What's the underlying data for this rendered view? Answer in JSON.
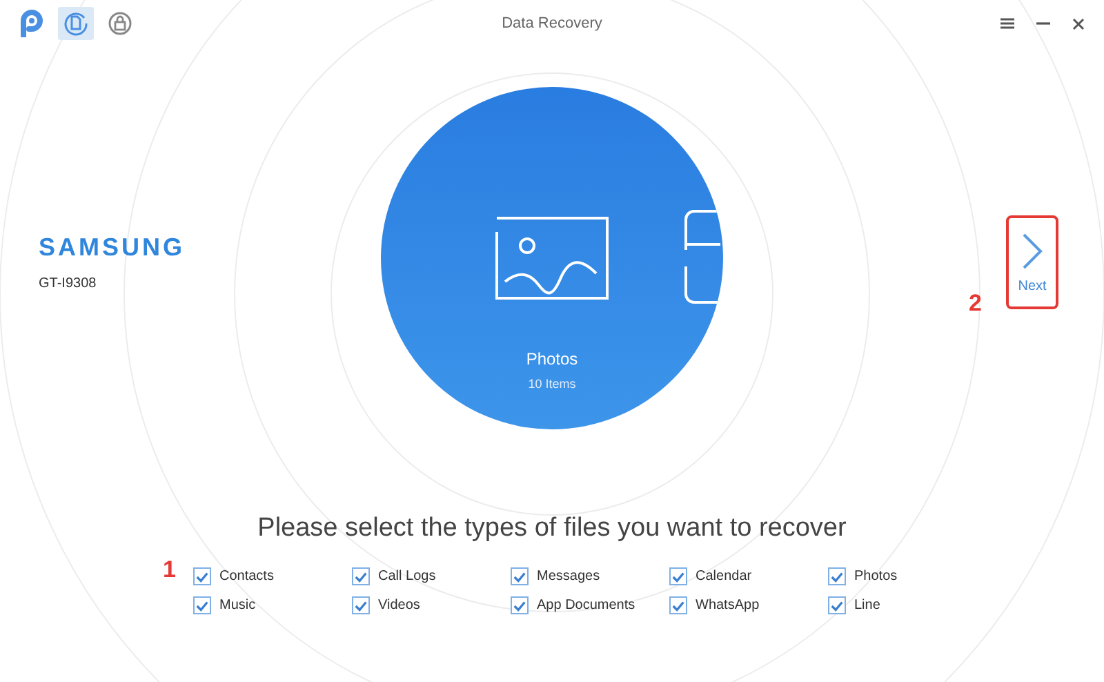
{
  "window": {
    "title": "Data Recovery"
  },
  "toolbar": [
    {
      "kind": "logo",
      "selected": false
    },
    {
      "kind": "recover",
      "selected": true
    },
    {
      "kind": "unlock",
      "selected": false
    }
  ],
  "device": {
    "brand": "SAMSUNG",
    "model": "GT-I9308"
  },
  "carousel": {
    "label": "Photos",
    "count": "10 Items"
  },
  "next_button": {
    "label": "Next",
    "annotation": "2"
  },
  "prompt": "Please select the types of files you want to recover",
  "file_types_annotation": "1",
  "file_types": [
    {
      "label": "Contacts",
      "checked": true
    },
    {
      "label": "Call Logs",
      "checked": true
    },
    {
      "label": "Messages",
      "checked": true
    },
    {
      "label": "Calendar",
      "checked": true
    },
    {
      "label": "Photos",
      "checked": true
    },
    {
      "label": "Music",
      "checked": true
    },
    {
      "label": "Videos",
      "checked": true
    },
    {
      "label": "App Documents",
      "checked": true
    },
    {
      "label": "WhatsApp",
      "checked": true
    },
    {
      "label": "Line",
      "checked": true
    }
  ]
}
